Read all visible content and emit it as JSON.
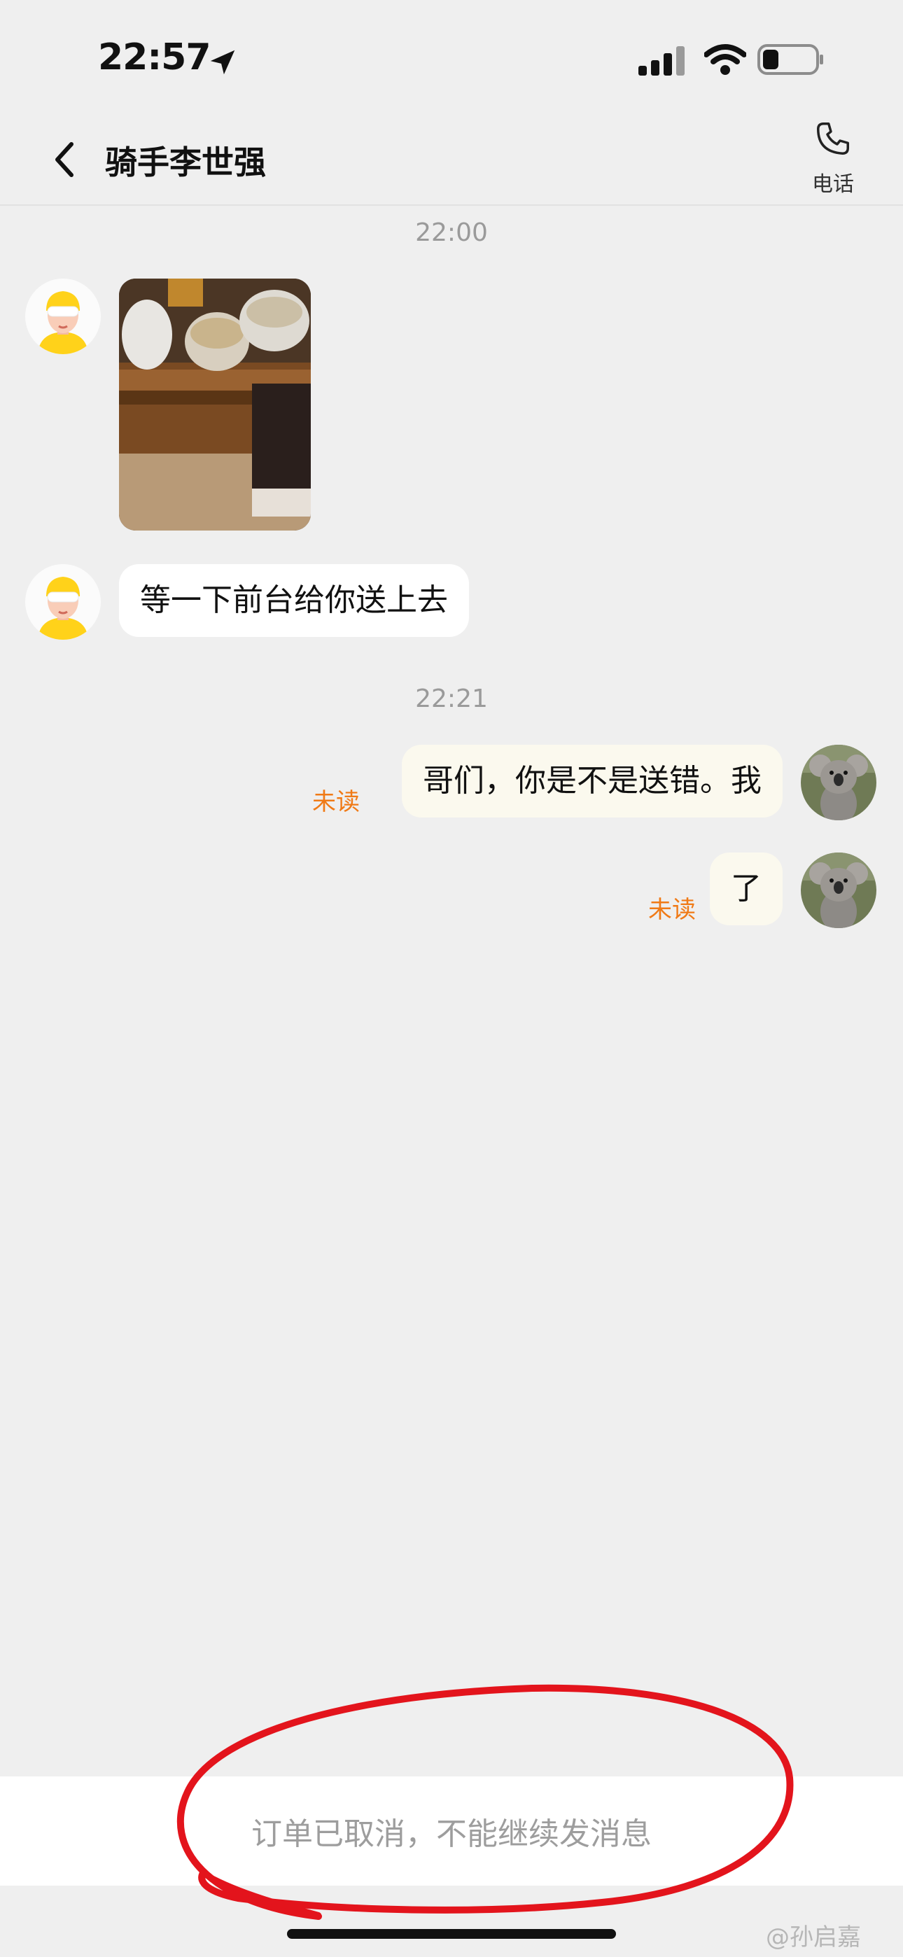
{
  "status_bar": {
    "time": "22:57"
  },
  "header": {
    "title": "骑手李世强",
    "phone_label": "电话"
  },
  "messages": [
    {
      "timestamp": "22:00"
    },
    {
      "from": "rider",
      "type": "image"
    },
    {
      "from": "rider",
      "type": "text",
      "text": "等一下前台给你送上去"
    },
    {
      "timestamp": "22:21"
    },
    {
      "from": "me",
      "type": "text",
      "text": "哥们，你是不是送错。我",
      "status": "未读"
    },
    {
      "from": "me",
      "type": "text",
      "text": "了",
      "status": "未读"
    }
  ],
  "footer": {
    "notice": "订单已取消，不能继续发消息"
  },
  "watermark": "@孙启嘉",
  "colors": {
    "annotation_circle": "#e3141c",
    "unread": "#f07a16",
    "rider_avatar": "#ffd21a"
  }
}
